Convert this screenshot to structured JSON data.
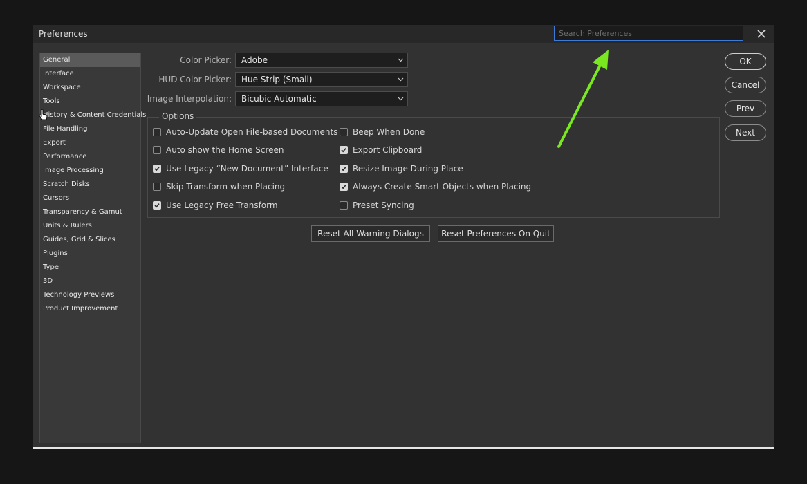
{
  "window": {
    "title": "Preferences",
    "search_placeholder": "Search Preferences"
  },
  "sidebar": {
    "items": [
      {
        "label": "General",
        "active": true
      },
      {
        "label": "Interface"
      },
      {
        "label": "Workspace"
      },
      {
        "label": "Tools"
      },
      {
        "label": "History & Content Credentials"
      },
      {
        "label": "File Handling"
      },
      {
        "label": "Export"
      },
      {
        "label": "Performance"
      },
      {
        "label": "Image Processing"
      },
      {
        "label": "Scratch Disks"
      },
      {
        "label": "Cursors"
      },
      {
        "label": "Transparency & Gamut"
      },
      {
        "label": "Units & Rulers"
      },
      {
        "label": "Guides, Grid & Slices"
      },
      {
        "label": "Plugins"
      },
      {
        "label": "Type"
      },
      {
        "label": "3D"
      },
      {
        "label": "Technology Previews"
      },
      {
        "label": "Product Improvement"
      }
    ]
  },
  "fields": {
    "color_picker": {
      "label": "Color Picker:",
      "value": "Adobe"
    },
    "hud_color_picker": {
      "label": "HUD Color Picker:",
      "value": "Hue Strip (Small)"
    },
    "image_interpolation": {
      "label": "Image Interpolation:",
      "value": "Bicubic Automatic"
    }
  },
  "options": {
    "legend": "Options",
    "left": [
      {
        "label": "Auto-Update Open File-based Documents",
        "checked": false
      },
      {
        "label": "Auto show the Home Screen",
        "checked": false
      },
      {
        "label": "Use Legacy “New Document” Interface",
        "checked": true
      },
      {
        "label": "Skip Transform when Placing",
        "checked": false
      },
      {
        "label": "Use Legacy Free Transform",
        "checked": true
      }
    ],
    "right": [
      {
        "label": "Beep When Done",
        "checked": false
      },
      {
        "label": "Export Clipboard",
        "checked": true
      },
      {
        "label": "Resize Image During Place",
        "checked": true
      },
      {
        "label": "Always Create Smart Objects when Placing",
        "checked": true
      },
      {
        "label": "Preset Syncing",
        "checked": false
      }
    ]
  },
  "reset_buttons": {
    "warnings": "Reset All Warning Dialogs",
    "on_quit": "Reset Preferences On Quit"
  },
  "actions": {
    "ok": "OK",
    "cancel": "Cancel",
    "prev": "Prev",
    "next": "Next"
  },
  "colors": {
    "annotation_arrow": "#7ae820",
    "search_focus": "#3f7bd6"
  }
}
